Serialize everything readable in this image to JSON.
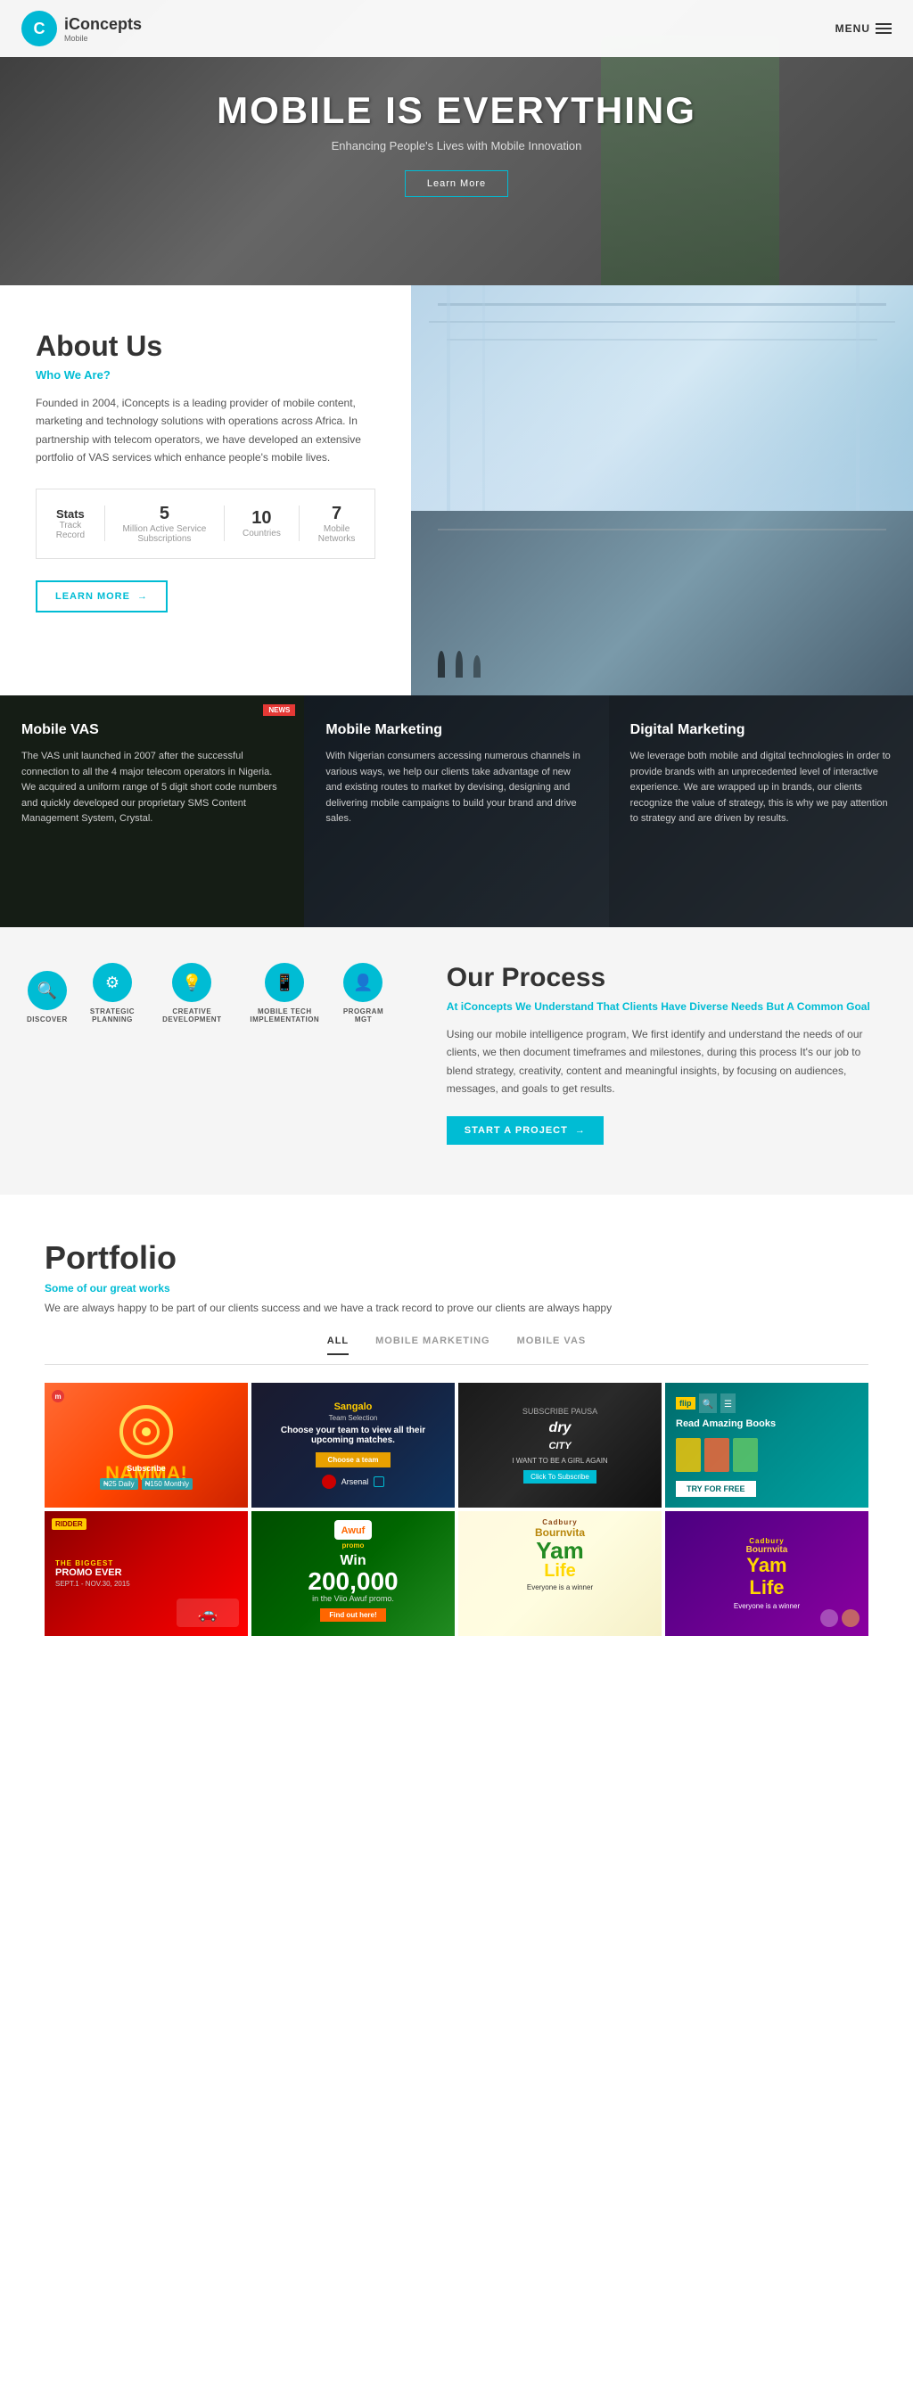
{
  "header": {
    "logo_letter": "C",
    "logo_name": "iConcepts",
    "logo_sub": "Mobile",
    "menu_label": "MENU"
  },
  "hero": {
    "title": "MOBILE IS EVERYTHING",
    "subtitle": "Enhancing People's Lives with Mobile Innovation",
    "cta_label": "Learn More"
  },
  "about": {
    "title": "About Us",
    "who_label": "Who We Are?",
    "description": "Founded in 2004, iConcepts is a leading provider of mobile content, marketing and technology solutions with operations across Africa. In partnership with telecom operators, we have developed an extensive portfolio of VAS services which enhance people's mobile lives.",
    "stats_label": "Stats",
    "stats_sublabel": "Track Record",
    "stat1_number": "5",
    "stat1_desc": "Million Active Service Subscriptions",
    "stat2_number": "10",
    "stat2_desc": "Countries",
    "stat3_number": "7",
    "stat3_desc": "Mobile Networks",
    "learn_more_btn": "LEARN MORE"
  },
  "services": {
    "card1_title": "Mobile VAS",
    "card1_text": "The VAS unit launched in 2007 after the successful connection to all the 4 major telecom operators in Nigeria. We acquired a uniform range of 5 digit short code numbers and quickly developed our proprietary SMS Content Management System, Crystal.",
    "card2_title": "Mobile Marketing",
    "card2_text": "With Nigerian consumers accessing numerous channels in various ways, we help our clients take advantage of new and existing routes to market by devising, designing and delivering mobile campaigns to build your brand and drive sales.",
    "card3_title": "Digital Marketing",
    "card3_text": "We leverage both mobile and digital technologies in order to provide brands with an unprecedented level of interactive experience. We are wrapped up in brands, our clients recognize the value of strategy, this is why we pay attention to strategy and are driven by results."
  },
  "process": {
    "title": "Our Process",
    "subtitle": "At iConcepts We Understand That Clients Have Diverse Needs But A Common Goal",
    "text": "Using our mobile intelligence program, We first identify and understand the needs of our clients, we then document timeframes and milestones, during this process It's our job to blend strategy, creativity, content and meaningful insights, by focusing on audiences, messages, and goals to get results.",
    "cta_label": "START A PROJECT",
    "icons": [
      {
        "label": "DISCOVER",
        "symbol": "🔍"
      },
      {
        "label": "STRATEGIC PLANNING",
        "symbol": "⚙"
      },
      {
        "label": "CREATIVE DEVELOPMENT",
        "symbol": "💡"
      },
      {
        "label": "MOBILE TECH IMPLEMENTATION",
        "symbol": "📱"
      },
      {
        "label": "PROGRAM MGT",
        "symbol": "👤"
      }
    ]
  },
  "portfolio": {
    "title": "Portfolio",
    "sub_label": "Some of our great works",
    "description": "We are always happy to be part of our clients success and we have a track record to prove our clients are always happy",
    "tabs": [
      {
        "label": "ALL",
        "active": true
      },
      {
        "label": "MOBILE MARKETING",
        "active": false
      },
      {
        "label": "MOBILE VAS",
        "active": false
      }
    ],
    "items": [
      {
        "id": 1,
        "name": "target-game",
        "bg": "port-1"
      },
      {
        "id": 2,
        "name": "team-selection",
        "bg": "port-2"
      },
      {
        "id": 3,
        "name": "dry-girl",
        "bg": "port-3"
      },
      {
        "id": 4,
        "name": "read-books",
        "bg": "port-4"
      },
      {
        "id": 5,
        "name": "biggest-promo",
        "bg": "port-5"
      },
      {
        "id": 6,
        "name": "awuf-promo",
        "bg": "port-6"
      },
      {
        "id": 7,
        "name": "bourn-vita",
        "bg": "port-7"
      },
      {
        "id": 8,
        "name": "yam-life",
        "bg": "port-8"
      }
    ],
    "subscribe": {
      "title": "Subscribe",
      "price1": "₦25 Daily",
      "price2": "₦150 Monthly"
    },
    "team": {
      "header": "Sangalo",
      "title": "Team Selection",
      "subtitle": "Choose your team to view all their upcoming matches.",
      "choose_label": "Choose a team",
      "team_name": "Arsenal"
    },
    "books": {
      "title": "Read Amazing Books",
      "cta": "TRY FOR FREE"
    },
    "awuf": {
      "logo": "Awuf",
      "label": "promo",
      "win_text": "Win",
      "amount": "200,000",
      "sub": "in the Viio Awuf promo."
    },
    "bourn": {
      "brand": "Bournvita",
      "title": "Yam Life",
      "sub": "Everyone is a winner"
    }
  }
}
